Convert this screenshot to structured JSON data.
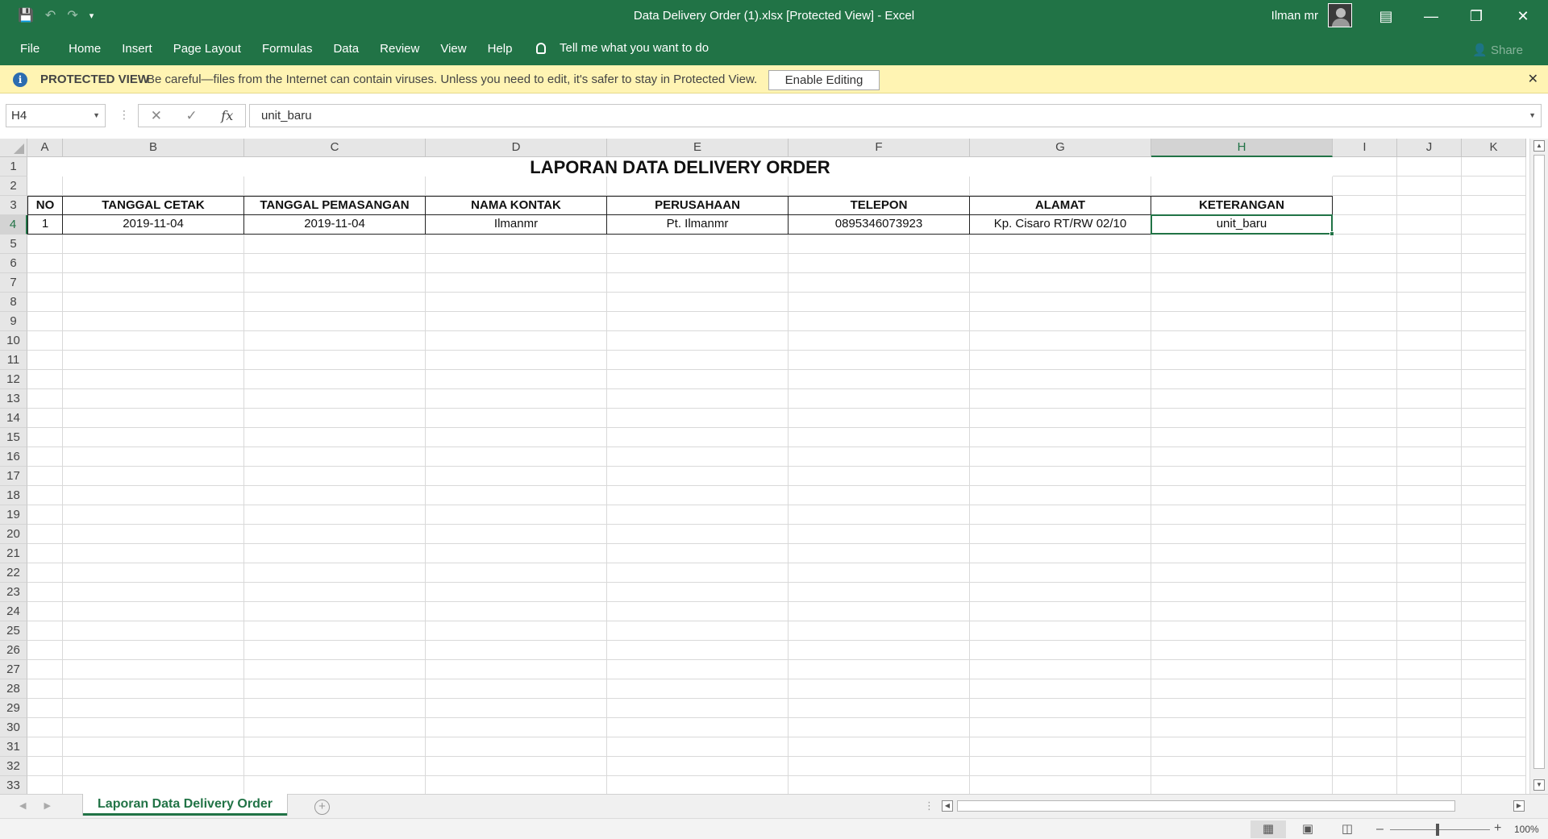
{
  "window": {
    "title": "Data Delivery Order (1).xlsx  [Protected View]  -  Excel",
    "user": "Ilman mr",
    "share_label": "Share"
  },
  "ribbon": {
    "tabs": [
      "File",
      "Home",
      "Insert",
      "Page Layout",
      "Formulas",
      "Data",
      "Review",
      "View",
      "Help"
    ],
    "tell_me": "Tell me what you want to do"
  },
  "protected_view": {
    "label": "PROTECTED VIEW",
    "message": "Be careful—files from the Internet can contain viruses. Unless you need to edit, it's safer to stay in Protected View.",
    "button": "Enable Editing"
  },
  "formula_bar": {
    "name_box": "H4",
    "fx": "fx",
    "content": "unit_baru"
  },
  "grid": {
    "columns": [
      "A",
      "B",
      "C",
      "D",
      "E",
      "F",
      "G",
      "H",
      "I",
      "J",
      "K"
    ],
    "selected_column": "H",
    "selected_row": 4,
    "rows": [
      "1",
      "2",
      "3",
      "4",
      "5",
      "6",
      "7",
      "8",
      "9",
      "10",
      "11",
      "12",
      "13",
      "14",
      "15",
      "16",
      "17",
      "18",
      "19",
      "20",
      "21",
      "22",
      "23",
      "24",
      "25",
      "26",
      "27",
      "28",
      "29",
      "30",
      "31",
      "32",
      "33"
    ],
    "title": "LAPORAN DATA DELIVERY ORDER",
    "headers": [
      "NO",
      "TANGGAL CETAK",
      "TANGGAL PEMASANGAN",
      "NAMA KONTAK",
      "PERUSAHAAN",
      "TELEPON",
      "ALAMAT",
      "KETERANGAN"
    ],
    "data_row": [
      "1",
      "2019-11-04",
      "2019-11-04",
      "Ilmanmr",
      "Pt. Ilmanmr",
      "0895346073923",
      "Kp. Cisaro RT/RW 02/10",
      "unit_baru"
    ]
  },
  "sheet_tabs": {
    "active": "Laporan Data Delivery Order"
  },
  "status_bar": {
    "zoom": "100%"
  },
  "colors": {
    "accent": "#217346",
    "protected_bg": "#fff4b3"
  }
}
